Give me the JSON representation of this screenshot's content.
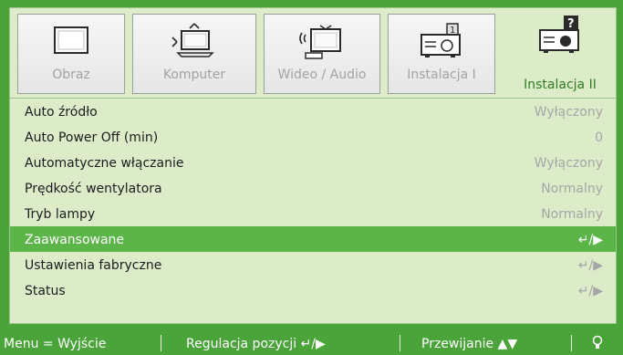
{
  "tabs": [
    {
      "label": "Obraz",
      "icon": "monitor-icon",
      "active": false
    },
    {
      "label": "Komputer",
      "icon": "computer-icon",
      "active": false
    },
    {
      "label": "Wideo / Audio",
      "icon": "video-audio-icon",
      "active": false
    },
    {
      "label": "Instalacja I",
      "icon": "projector-icon",
      "active": false
    },
    {
      "label": "Instalacja II",
      "icon": "projector-help-icon",
      "active": true
    }
  ],
  "rows": [
    {
      "label": "Auto źródło",
      "value": "Wyłączony",
      "selected": false
    },
    {
      "label": "Auto Power Off (min)",
      "value": "0",
      "selected": false
    },
    {
      "label": "Automatyczne włączanie",
      "value": "Wyłączony",
      "selected": false
    },
    {
      "label": "Prędkość wentylatora",
      "value": "Normalny",
      "selected": false
    },
    {
      "label": "Tryb lampy",
      "value": "Normalny",
      "selected": false
    },
    {
      "label": "Zaawansowane",
      "value": "↵/▶",
      "selected": true
    },
    {
      "label": "Ustawienia fabryczne",
      "value": "↵/▶",
      "selected": false
    },
    {
      "label": "Status",
      "value": "↵/▶",
      "selected": false
    }
  ],
  "footer": {
    "menu": "Menu = Wyjście",
    "adjust": "Regulacja pozycji ↵/▶",
    "scroll": "Przewijanie ▲▼"
  },
  "colors": {
    "accent": "#4aa43a",
    "selected_row": "#5cb548",
    "panel": "#dcebc8",
    "active_tab_text": "#2f7d25"
  }
}
